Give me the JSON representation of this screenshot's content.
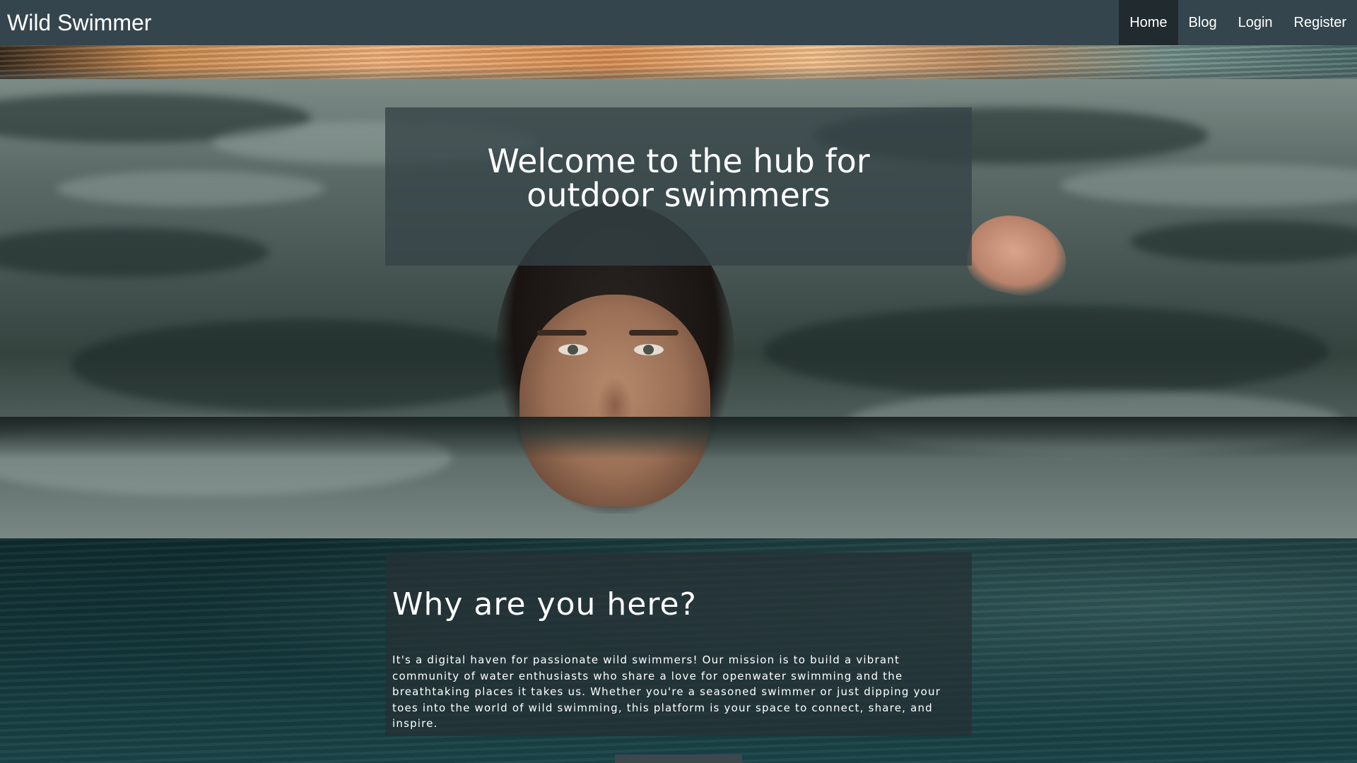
{
  "navbar": {
    "brand": "Wild Swimmer",
    "links": [
      "Home",
      "Blog",
      "Login",
      "Register"
    ],
    "active": "Home"
  },
  "hero": {
    "title": "Welcome to the hub for outdoor swimmers"
  },
  "why": {
    "title": "Why are you here?",
    "text": "It's a digital haven for passionate wild swimmers! Our mission is to build a vibrant community of water enthusiasts who share a love for openwater swimming and the breathtaking places it takes us. Whether you're a seasoned swimmer or just dipping your toes into the world of wild swimming, this platform is your space to connect, share, and inspire."
  },
  "colors": {
    "navbar": "#35454d",
    "nav_active": "#212a2f",
    "overlay_box": "#354246",
    "text": "#ffffff"
  }
}
